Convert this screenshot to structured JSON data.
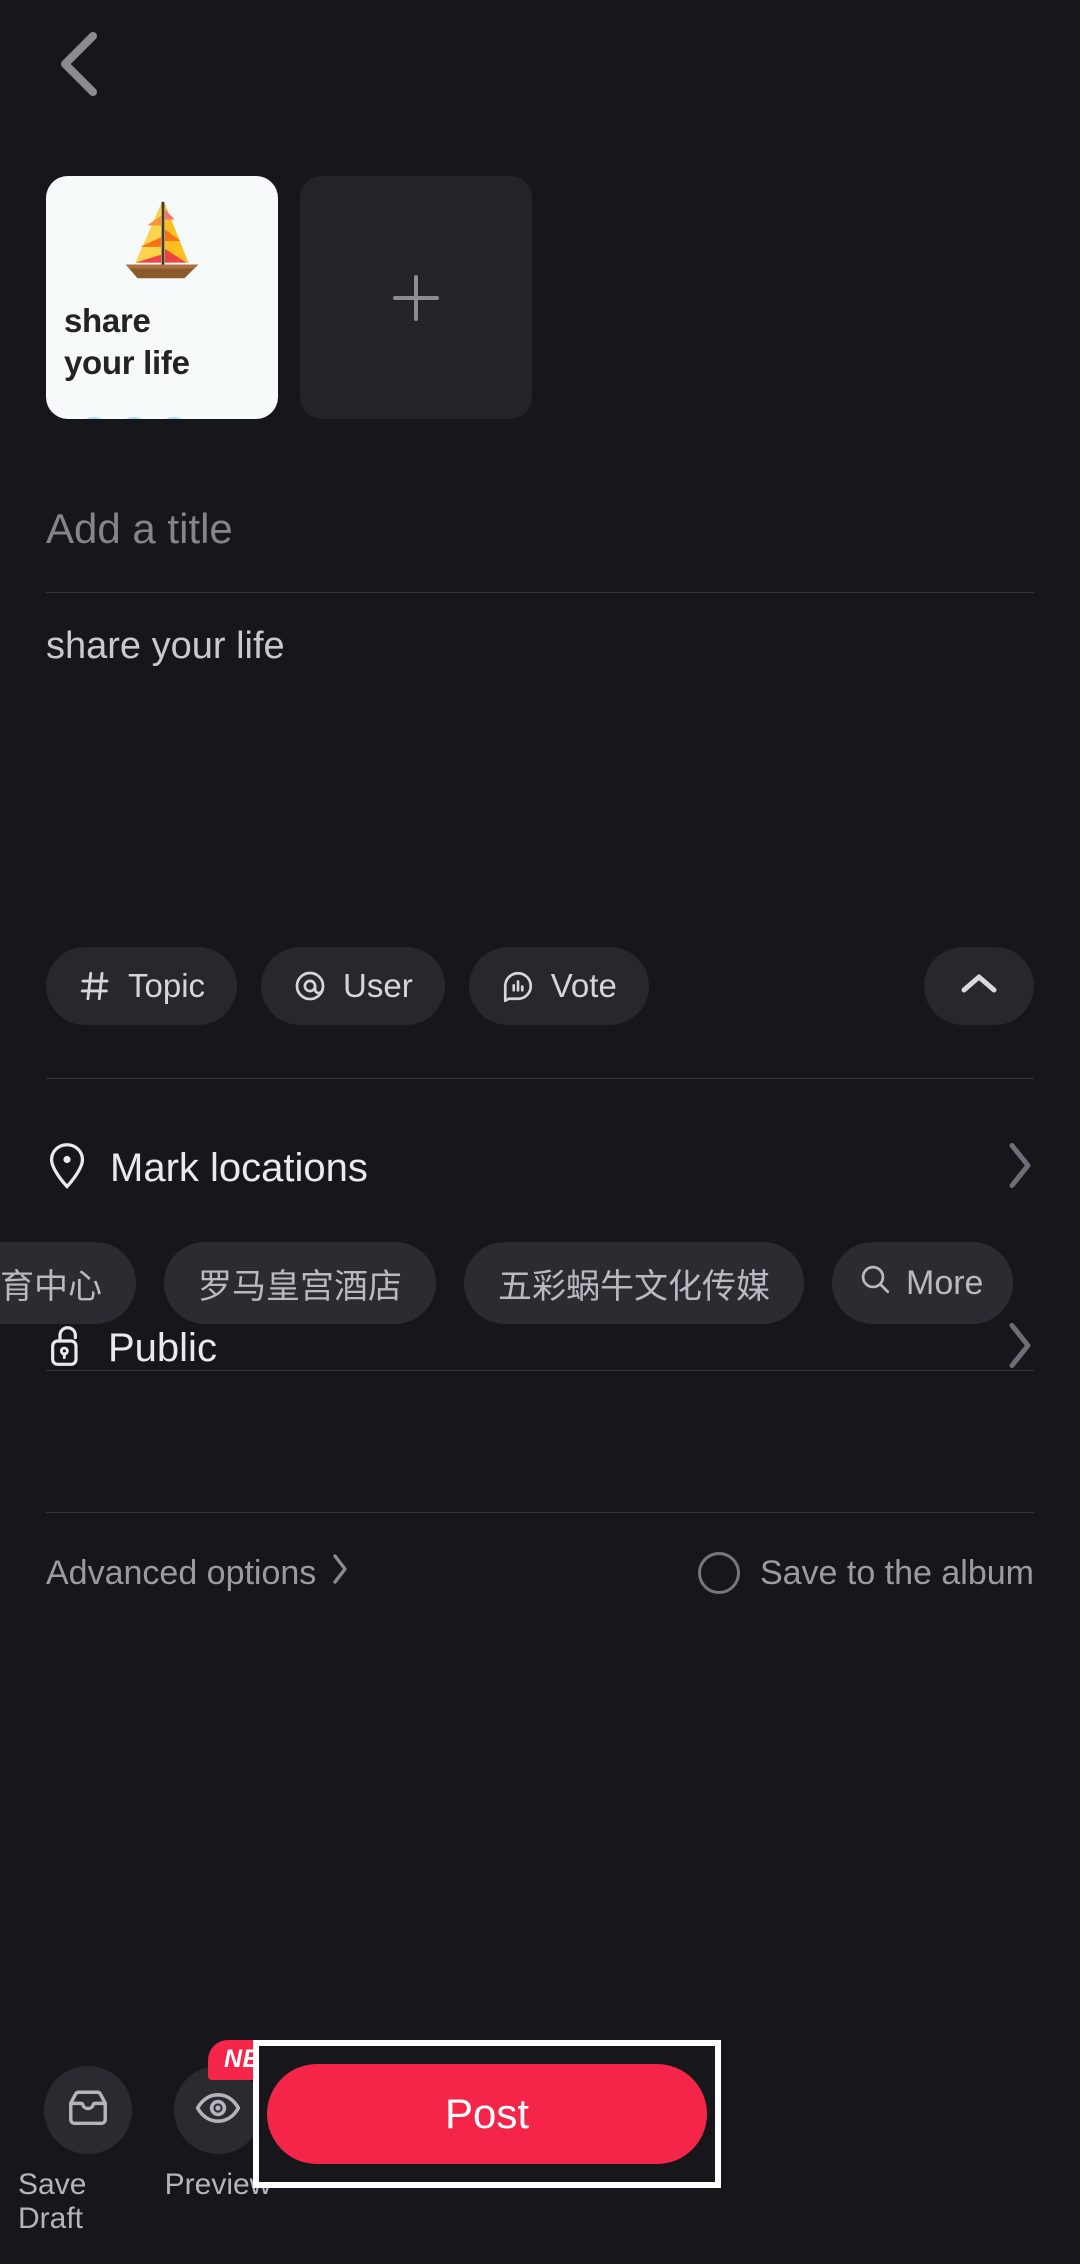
{
  "header": {
    "back_icon": "chevron-left-icon"
  },
  "media": {
    "cover": {
      "emoji": "sailboat",
      "line1": "share",
      "line2": "your  life"
    },
    "add_tile_icon": "plus-icon"
  },
  "compose": {
    "title_placeholder": "Add a title",
    "caption_text": "share your life"
  },
  "action_chips": [
    {
      "label": "Topic",
      "icon": "hash-icon"
    },
    {
      "label": "User",
      "icon": "at-icon"
    },
    {
      "label": "Vote",
      "icon": "poll-bubble-icon"
    }
  ],
  "collapse": {
    "icon": "chevron-up-icon"
  },
  "locations": {
    "row_label": "Mark locations",
    "row_icon": "location-pin-icon",
    "chevron": "chevron-right-icon",
    "chips": [
      {
        "label": "体育中心",
        "icon": ""
      },
      {
        "label": "罗马皇宫酒店",
        "icon": ""
      },
      {
        "label": "五彩蜗牛文化传媒",
        "icon": ""
      },
      {
        "label": "More",
        "icon": "search-icon"
      }
    ]
  },
  "privacy": {
    "label": "Public",
    "icon": "unlock-icon",
    "chevron": "chevron-right-icon"
  },
  "advanced": {
    "label": "Advanced options",
    "chevron": "chevron-right-icon",
    "save_album_label": "Save to the album",
    "save_album_checked": false
  },
  "bottom_bar": {
    "save_draft": {
      "label": "Save Draft",
      "icon": "inbox-tray-icon"
    },
    "preview": {
      "label": "Preview",
      "icon": "eye-icon",
      "badge": "NEW"
    },
    "post": {
      "label": "Post"
    }
  },
  "colors": {
    "background": "#17171b",
    "accent_red": "#f5254a",
    "chip_bg": "#27272c",
    "text_primary": "#eaeaee",
    "text_secondary": "#9a9aa2",
    "highlight_frame": "#ffffff"
  }
}
